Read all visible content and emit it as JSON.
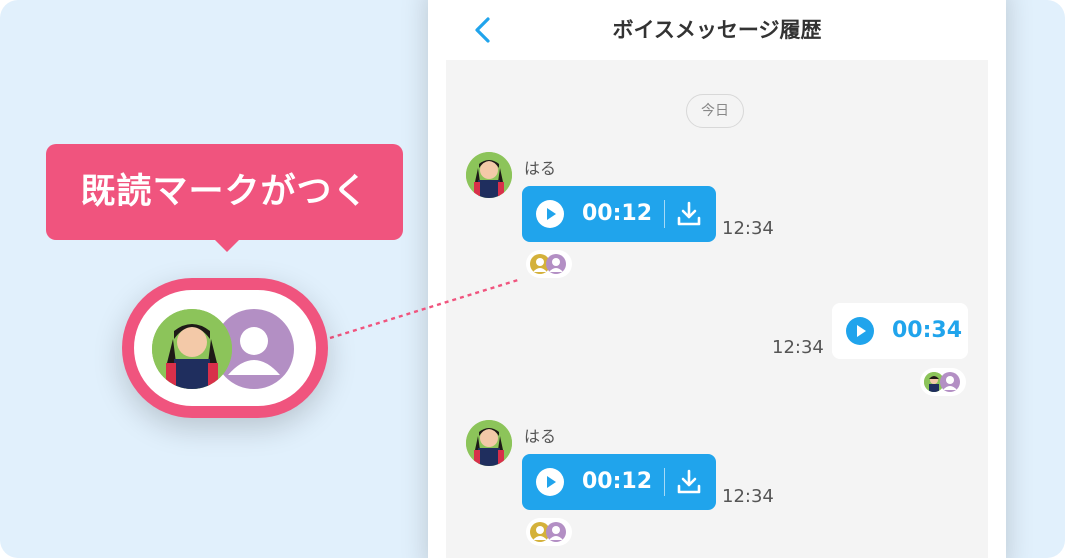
{
  "header": {
    "title": "ボイスメッセージ履歴"
  },
  "date_separator": "今日",
  "messages": [
    {
      "sender": "はる",
      "duration": "00:12",
      "time": "12:34",
      "direction": "incoming"
    },
    {
      "sender": "",
      "duration": "00:34",
      "time": "12:34",
      "direction": "outgoing"
    },
    {
      "sender": "はる",
      "duration": "00:12",
      "time": "12:34",
      "direction": "incoming"
    }
  ],
  "callout": {
    "text": "既読マークがつく"
  },
  "colors": {
    "accent_blue": "#20a4ec",
    "callout_pink": "#f0547e",
    "background": "#e1f0fc",
    "read_avatar_purple": "#b38fc4",
    "read_avatar_gold": "#d4b13a"
  },
  "icons": {
    "back": "chevron-left-icon",
    "play": "play-icon",
    "download": "download-icon",
    "user": "user-silhouette-icon"
  }
}
